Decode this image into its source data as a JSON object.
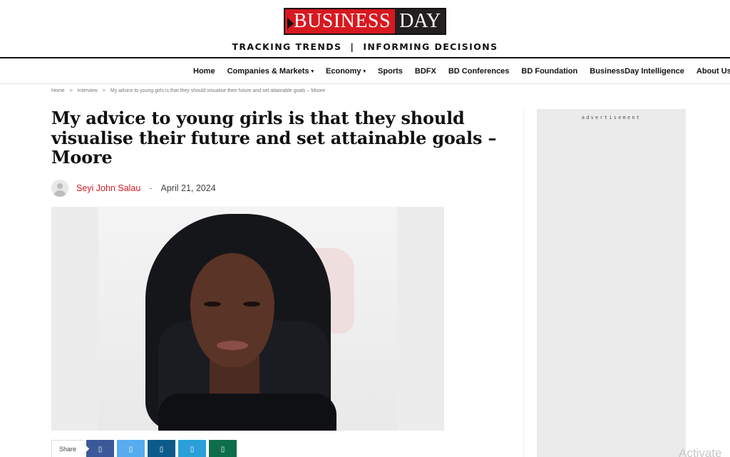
{
  "brand": {
    "logo_left": "BUSINESS",
    "logo_right": "DAY",
    "tagline_left": "TRACKING TRENDS",
    "tagline_sep": "|",
    "tagline_right": "INFORMING DECISIONS",
    "accent_color": "#d71920"
  },
  "nav": {
    "items": [
      {
        "label": "Home",
        "dropdown": false
      },
      {
        "label": "Companies & Markets",
        "dropdown": true
      },
      {
        "label": "Economy",
        "dropdown": true
      },
      {
        "label": "Sports",
        "dropdown": false
      },
      {
        "label": "BDFX",
        "dropdown": false
      },
      {
        "label": "BD Conferences",
        "dropdown": false
      },
      {
        "label": "BD Foundation",
        "dropdown": false
      },
      {
        "label": "BusinessDay Intelligence",
        "dropdown": false
      },
      {
        "label": "About Us",
        "dropdown": true
      }
    ],
    "caret": "▾"
  },
  "breadcrumb": {
    "items": [
      "Home",
      "Interview",
      "My advice to young girls is that they should visualise their future and set attainable goals – Moore"
    ],
    "separator": ">"
  },
  "article": {
    "title": "My advice to young girls is that they should visualise their future and set attainable goals – Moore",
    "author": "Seyi John Salau",
    "meta_separator": "-",
    "date": "April 21, 2024",
    "image_alt": "Portrait of a woman with long black hair"
  },
  "share": {
    "label": "Share",
    "buttons": [
      {
        "name": "facebook",
        "icon": "facebook-icon",
        "glyph": "▯",
        "color": "#3b5998"
      },
      {
        "name": "twitter",
        "icon": "twitter-icon",
        "glyph": "▯",
        "color": "#55acee"
      },
      {
        "name": "linkedin",
        "icon": "linkedin-icon",
        "glyph": "▯",
        "color": "#0b5a8a"
      },
      {
        "name": "telegram",
        "icon": "telegram-icon",
        "glyph": "▯",
        "color": "#2a9fd8"
      },
      {
        "name": "whatsapp",
        "icon": "whatsapp-icon",
        "glyph": "▯",
        "color": "#0f6e4a"
      }
    ]
  },
  "sidebar": {
    "ad_label": "advertisement"
  },
  "overlay": {
    "watermark": "Activate"
  }
}
